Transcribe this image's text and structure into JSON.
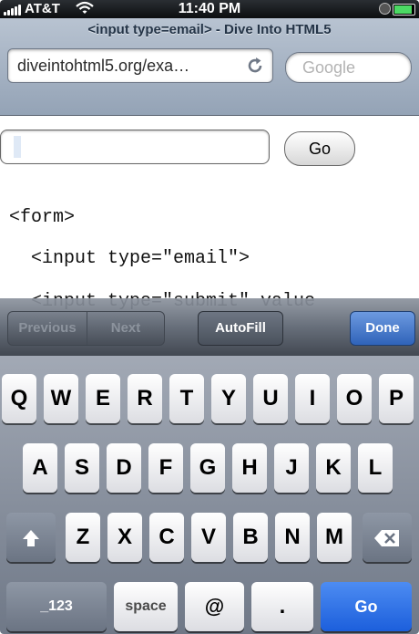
{
  "status_bar": {
    "carrier": "AT&T",
    "time": "11:40 PM",
    "battery_level": 1.0
  },
  "browser": {
    "page_title": "<input type=email> - Dive Into HTML5",
    "url": "diveintohtml5.org/exa…",
    "search_placeholder": "Google"
  },
  "page": {
    "go_button": "Go",
    "code_lines": [
      "<form>",
      "  <input type=\"email\">",
      "  <input type=\"submit\" value"
    ]
  },
  "form_assistant": {
    "previous": "Previous",
    "next": "Next",
    "autofill": "AutoFill",
    "done": "Done"
  },
  "keyboard": {
    "row1": [
      "Q",
      "W",
      "E",
      "R",
      "T",
      "Y",
      "U",
      "I",
      "O",
      "P"
    ],
    "row2": [
      "A",
      "S",
      "D",
      "F",
      "G",
      "H",
      "J",
      "K",
      "L"
    ],
    "row3": [
      "Z",
      "X",
      "C",
      "V",
      "B",
      "N",
      "M"
    ],
    "numbers_key": "_123",
    "space_key": "space",
    "at_key": "@",
    "dot_key": ".",
    "go_key": "Go",
    "shift_icon": "shift-arrow-icon",
    "delete_icon": "backspace-icon"
  },
  "colors": {
    "go_key_blue": "#1c5fdc",
    "done_blue": "#2f63b9",
    "battery_green": "#4cd964"
  }
}
